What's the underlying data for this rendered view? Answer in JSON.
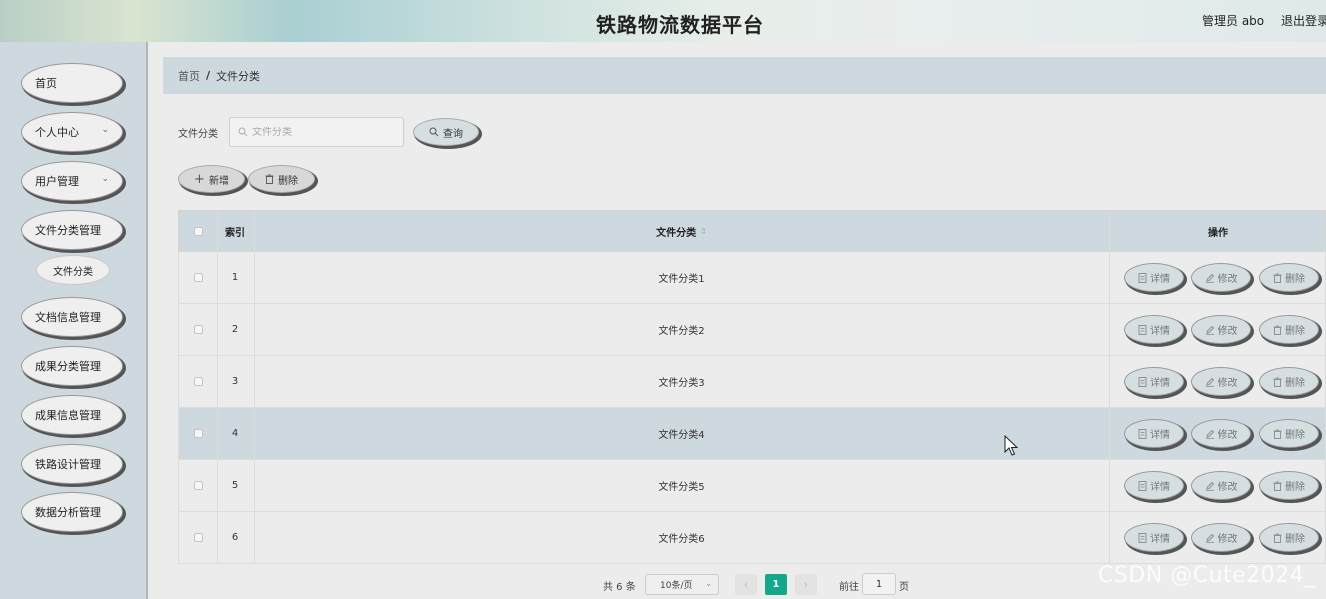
{
  "header": {
    "title": "铁路物流数据平台",
    "user": "管理员 abo",
    "logout": "退出登录"
  },
  "sidebar": {
    "items": [
      {
        "label": "首页",
        "has_chevron": false
      },
      {
        "label": "个人中心",
        "has_chevron": true
      },
      {
        "label": "用户管理",
        "has_chevron": true
      },
      {
        "label": "文件分类管理",
        "has_chevron": false
      },
      {
        "label": "文档信息管理",
        "has_chevron": false
      },
      {
        "label": "成果分类管理",
        "has_chevron": false
      },
      {
        "label": "成果信息管理",
        "has_chevron": false
      },
      {
        "label": "铁路设计管理",
        "has_chevron": false
      },
      {
        "label": "数据分析管理",
        "has_chevron": false
      }
    ],
    "sub_item": "文件分类"
  },
  "breadcrumb": {
    "home": "首页",
    "separator": "/",
    "current": "文件分类"
  },
  "search": {
    "label": "文件分类",
    "placeholder": "文件分类",
    "value": "",
    "button": "查询"
  },
  "toolbar": {
    "add": "新增",
    "delete": "删除"
  },
  "table": {
    "headers": {
      "index": "索引",
      "category": "文件分类",
      "actions": "操作"
    },
    "rows": [
      {
        "index": "1",
        "category": "文件分类1"
      },
      {
        "index": "2",
        "category": "文件分类2"
      },
      {
        "index": "3",
        "category": "文件分类3"
      },
      {
        "index": "4",
        "category": "文件分类4",
        "highlighted": true
      },
      {
        "index": "5",
        "category": "文件分类5"
      },
      {
        "index": "6",
        "category": "文件分类6"
      }
    ],
    "row_actions": {
      "detail": "详情",
      "edit": "修改",
      "delete": "删除"
    }
  },
  "pagination": {
    "total": "共 6 条",
    "page_size": "10条/页",
    "prev": "‹",
    "current_page": "1",
    "next": "›",
    "goto": "前往",
    "goto_value": "1",
    "unit": "页"
  },
  "watermark": "CSDN @Cute2024_",
  "colors": {
    "accent": "#13a88a",
    "panel": "#cdd9df",
    "background": "#ececec"
  }
}
